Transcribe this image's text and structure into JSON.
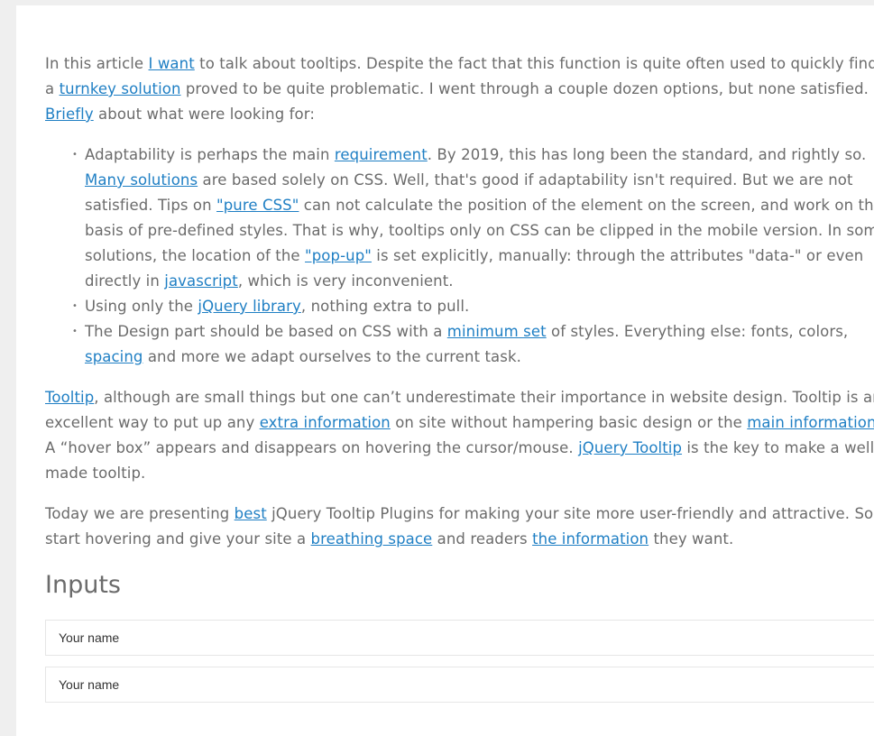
{
  "intro": {
    "t1": "In this article ",
    "l1": "I want",
    "t2": " to talk about tooltips. Despite the fact that this function is quite often used to quickly find a ",
    "l2": "turnkey solution",
    "t3": " proved to be quite problematic. I went through a couple dozen options, but none satisfied. ",
    "l3": "Briefly",
    "t4": " about what were looking for:"
  },
  "list": {
    "item1": {
      "t1": "Adaptability is perhaps the main ",
      "l1": "requirement",
      "t2": ". By 2019, this has long been the standard, and rightly so. ",
      "l2": "Many solutions",
      "t3": " are based solely on CSS. Well, that's good if adaptability isn't required. But we are not satisfied. Tips on ",
      "l3": "\"pure CSS\"",
      "t4": " can not calculate the position of the element on the screen, and work on the basis of pre-defined styles. That is why, tooltips only on CSS can be clipped in the mobile version. In some solutions, the location of the ",
      "l4": "\"pop-up\"",
      "t5": " is set explicitly, manually: through the attributes \"data-\" or even directly in ",
      "l5": "javascript",
      "t6": ", which is very inconvenient."
    },
    "item2": {
      "t1": "Using only the ",
      "l1": "jQuery library",
      "t2": ", nothing extra to pull."
    },
    "item3": {
      "t1": "The Design part should be based on CSS with a ",
      "l1": "minimum set",
      "t2": " of styles. Everything else: fonts, colors, ",
      "l2": "spacing",
      "t3": " and more we adapt ourselves to the current task."
    }
  },
  "para2": {
    "l1": "Tooltip",
    "t1": ", although are small things but one can’t underestimate their importance in website design. Tooltip is an excellent way to put up any ",
    "l2": "extra information",
    "t2": " on site without hampering basic design or the ",
    "l3": "main information",
    "t3": ". A “hover box” appears and disappears on hovering the cursor/mouse. ",
    "l4": "jQuery Tooltip",
    "t4": " is the key to make a well made tooltip."
  },
  "para3": {
    "t1": "Today we are presenting ",
    "l1": "best",
    "t2": " jQuery Tooltip Plugins for making your site more user-friendly and attractive. So start hovering and give your site a ",
    "l2": "breathing space",
    "t3": " and readers ",
    "l3": "the information",
    "t4": " they want."
  },
  "inputs": {
    "heading": "Inputs",
    "field1_placeholder": "Your name",
    "field2_placeholder": "Your name"
  }
}
